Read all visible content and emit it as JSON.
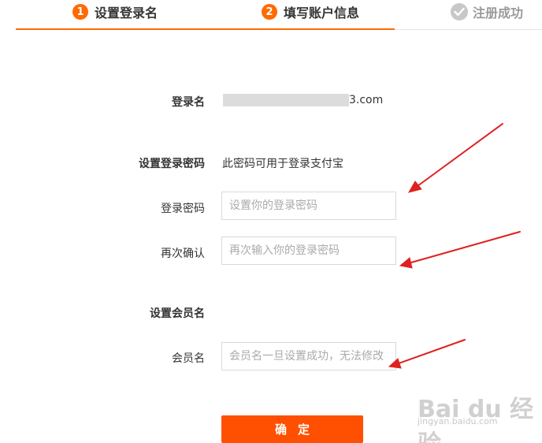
{
  "steps": [
    {
      "number": "1",
      "label": "设置登录名"
    },
    {
      "number": "2",
      "label": "填写账户信息"
    },
    {
      "label": "注册成功"
    }
  ],
  "form": {
    "login_name_label": "登录名",
    "login_name_suffix": "3.com",
    "password_section_label": "设置登录密码",
    "password_note": "此密码可用于登录支付宝",
    "password_label": "登录密码",
    "password_placeholder": "设置你的登录密码",
    "confirm_label": "再次确认",
    "confirm_placeholder": "再次输入你的登录密码",
    "member_section_label": "设置会员名",
    "member_label": "会员名",
    "member_placeholder": "会员名一旦设置成功，无法修改",
    "submit_label": "确定"
  },
  "watermark": {
    "logo": "Bai du 经验",
    "url": "jingyan.baidu.com"
  },
  "colors": {
    "accent": "#ff6a00",
    "button": "#ff4f00",
    "annotation_arrow": "#e02020"
  }
}
